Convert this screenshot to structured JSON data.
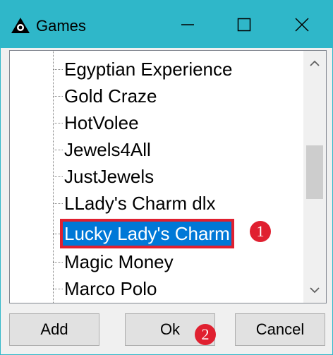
{
  "window": {
    "title": "Games",
    "icon": "game-logo-icon",
    "controls": [
      "minimize-icon",
      "maximize-icon",
      "close-icon"
    ]
  },
  "games_list": {
    "items": [
      {
        "label": "Egyptian Experience",
        "selected": false
      },
      {
        "label": "Gold Craze",
        "selected": false
      },
      {
        "label": "HotVolee",
        "selected": false
      },
      {
        "label": "Jewels4All",
        "selected": false
      },
      {
        "label": "JustJewels",
        "selected": false
      },
      {
        "label": "LLady's Charm dlx",
        "selected": false
      },
      {
        "label": "Lucky Lady's Charm",
        "selected": true
      },
      {
        "label": "Magic Money",
        "selected": false
      },
      {
        "label": "Marco Polo",
        "selected": false
      }
    ]
  },
  "buttons": {
    "add": "Add",
    "ok": "Ok",
    "cancel": "Cancel"
  },
  "annotations": {
    "step1": "1",
    "step2": "2"
  },
  "colors": {
    "titlebar": "#2fb7c9",
    "selection": "#0078d7",
    "highlight": "#e02030"
  }
}
